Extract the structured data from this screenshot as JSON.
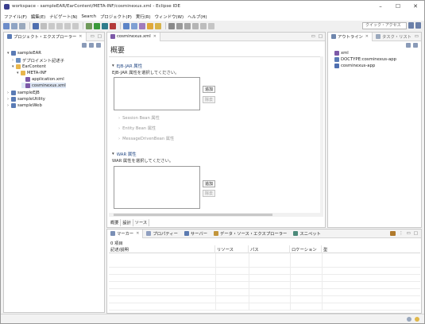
{
  "window": {
    "title": "workspace - sampleEAR/EarContent/META-INF/cosminexus.xml - Eclipse IDE",
    "controls": [
      "–",
      "☐",
      "✕"
    ]
  },
  "menu": [
    "ファイル(F)",
    "編集(E)",
    "ナビゲート(N)",
    "Search",
    "プロジェクト(P)",
    "実行(R)",
    "ウィンドウ(W)",
    "ヘルプ(H)"
  ],
  "toolbar": {
    "quick_access_placeholder": "クイック・アクセス"
  },
  "explorer": {
    "tab_label": "プロジェクト・エクスプローラー",
    "nodes": [
      {
        "label": "sampleEAR",
        "twisty": "▾"
      },
      {
        "label": "デプロイメント記述子",
        "twisty": "›"
      },
      {
        "label": "EarContent",
        "twisty": "▾"
      },
      {
        "label": "META-INF",
        "twisty": "▾"
      },
      {
        "label": "application.xml",
        "twisty": ""
      },
      {
        "label": "cosminexus.xml",
        "twisty": ""
      },
      {
        "label": "sampleEJB",
        "twisty": "›"
      },
      {
        "label": "sampleUtility",
        "twisty": "›"
      },
      {
        "label": "sampleWeb",
        "twisty": "›"
      }
    ]
  },
  "editor": {
    "tab_label": "cosminexus.xml",
    "form_title": "概要",
    "ejb_section": {
      "title": "EJB-JAR 属性",
      "description": "EJB-JAR 属性を選択してください。",
      "add_label": "追加",
      "remove_label": "除去",
      "subsections": [
        "Session Bean 属性",
        "Entity Bean 属性",
        "MessageDrivenBean 属性"
      ]
    },
    "war_section": {
      "title": "WAR 属性",
      "description": "WAR 属性を選択してください。",
      "add_label": "追加",
      "remove_label": "除去"
    },
    "bottom_tabs": [
      "概要",
      "設計",
      "ソース"
    ]
  },
  "outline": {
    "tab_label": "アウトライン",
    "tab2_label": "タスク・リスト",
    "nodes": [
      "xml",
      "DOCTYPE:cosminexus-app",
      "cosminexus-app"
    ]
  },
  "markers": {
    "tabs": [
      "マーカー",
      "プロパティー",
      "サーバー",
      "データ・ソース・エクスプローラー",
      "スニペット"
    ],
    "items_count": "0 項目",
    "columns": [
      "記述/説明",
      "リソース",
      "パス",
      "ロケーション",
      "型"
    ]
  },
  "colors": {
    "accent": "#2a4e88",
    "folder": "#e8b64c",
    "project": "#5a7bb5",
    "xml_file": "#7d5aa8"
  }
}
